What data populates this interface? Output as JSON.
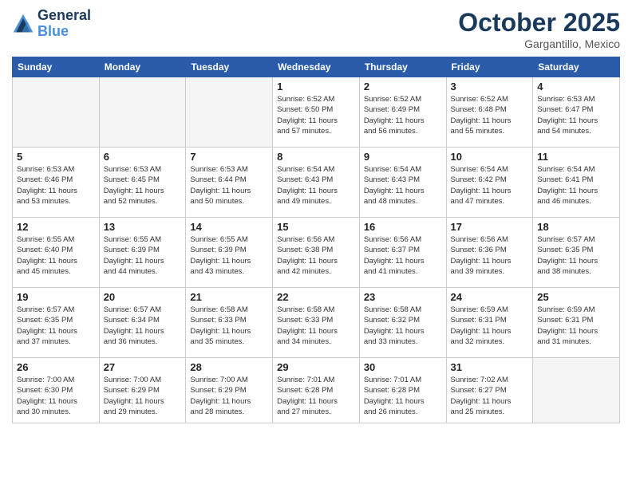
{
  "header": {
    "logo_line1": "General",
    "logo_line2": "Blue",
    "month": "October 2025",
    "location": "Gargantillo, Mexico"
  },
  "days_of_week": [
    "Sunday",
    "Monday",
    "Tuesday",
    "Wednesday",
    "Thursday",
    "Friday",
    "Saturday"
  ],
  "weeks": [
    [
      {
        "day": "",
        "info": ""
      },
      {
        "day": "",
        "info": ""
      },
      {
        "day": "",
        "info": ""
      },
      {
        "day": "1",
        "info": "Sunrise: 6:52 AM\nSunset: 6:50 PM\nDaylight: 11 hours\nand 57 minutes."
      },
      {
        "day": "2",
        "info": "Sunrise: 6:52 AM\nSunset: 6:49 PM\nDaylight: 11 hours\nand 56 minutes."
      },
      {
        "day": "3",
        "info": "Sunrise: 6:52 AM\nSunset: 6:48 PM\nDaylight: 11 hours\nand 55 minutes."
      },
      {
        "day": "4",
        "info": "Sunrise: 6:53 AM\nSunset: 6:47 PM\nDaylight: 11 hours\nand 54 minutes."
      }
    ],
    [
      {
        "day": "5",
        "info": "Sunrise: 6:53 AM\nSunset: 6:46 PM\nDaylight: 11 hours\nand 53 minutes."
      },
      {
        "day": "6",
        "info": "Sunrise: 6:53 AM\nSunset: 6:45 PM\nDaylight: 11 hours\nand 52 minutes."
      },
      {
        "day": "7",
        "info": "Sunrise: 6:53 AM\nSunset: 6:44 PM\nDaylight: 11 hours\nand 50 minutes."
      },
      {
        "day": "8",
        "info": "Sunrise: 6:54 AM\nSunset: 6:43 PM\nDaylight: 11 hours\nand 49 minutes."
      },
      {
        "day": "9",
        "info": "Sunrise: 6:54 AM\nSunset: 6:43 PM\nDaylight: 11 hours\nand 48 minutes."
      },
      {
        "day": "10",
        "info": "Sunrise: 6:54 AM\nSunset: 6:42 PM\nDaylight: 11 hours\nand 47 minutes."
      },
      {
        "day": "11",
        "info": "Sunrise: 6:54 AM\nSunset: 6:41 PM\nDaylight: 11 hours\nand 46 minutes."
      }
    ],
    [
      {
        "day": "12",
        "info": "Sunrise: 6:55 AM\nSunset: 6:40 PM\nDaylight: 11 hours\nand 45 minutes."
      },
      {
        "day": "13",
        "info": "Sunrise: 6:55 AM\nSunset: 6:39 PM\nDaylight: 11 hours\nand 44 minutes."
      },
      {
        "day": "14",
        "info": "Sunrise: 6:55 AM\nSunset: 6:39 PM\nDaylight: 11 hours\nand 43 minutes."
      },
      {
        "day": "15",
        "info": "Sunrise: 6:56 AM\nSunset: 6:38 PM\nDaylight: 11 hours\nand 42 minutes."
      },
      {
        "day": "16",
        "info": "Sunrise: 6:56 AM\nSunset: 6:37 PM\nDaylight: 11 hours\nand 41 minutes."
      },
      {
        "day": "17",
        "info": "Sunrise: 6:56 AM\nSunset: 6:36 PM\nDaylight: 11 hours\nand 39 minutes."
      },
      {
        "day": "18",
        "info": "Sunrise: 6:57 AM\nSunset: 6:35 PM\nDaylight: 11 hours\nand 38 minutes."
      }
    ],
    [
      {
        "day": "19",
        "info": "Sunrise: 6:57 AM\nSunset: 6:35 PM\nDaylight: 11 hours\nand 37 minutes."
      },
      {
        "day": "20",
        "info": "Sunrise: 6:57 AM\nSunset: 6:34 PM\nDaylight: 11 hours\nand 36 minutes."
      },
      {
        "day": "21",
        "info": "Sunrise: 6:58 AM\nSunset: 6:33 PM\nDaylight: 11 hours\nand 35 minutes."
      },
      {
        "day": "22",
        "info": "Sunrise: 6:58 AM\nSunset: 6:33 PM\nDaylight: 11 hours\nand 34 minutes."
      },
      {
        "day": "23",
        "info": "Sunrise: 6:58 AM\nSunset: 6:32 PM\nDaylight: 11 hours\nand 33 minutes."
      },
      {
        "day": "24",
        "info": "Sunrise: 6:59 AM\nSunset: 6:31 PM\nDaylight: 11 hours\nand 32 minutes."
      },
      {
        "day": "25",
        "info": "Sunrise: 6:59 AM\nSunset: 6:31 PM\nDaylight: 11 hours\nand 31 minutes."
      }
    ],
    [
      {
        "day": "26",
        "info": "Sunrise: 7:00 AM\nSunset: 6:30 PM\nDaylight: 11 hours\nand 30 minutes."
      },
      {
        "day": "27",
        "info": "Sunrise: 7:00 AM\nSunset: 6:29 PM\nDaylight: 11 hours\nand 29 minutes."
      },
      {
        "day": "28",
        "info": "Sunrise: 7:00 AM\nSunset: 6:29 PM\nDaylight: 11 hours\nand 28 minutes."
      },
      {
        "day": "29",
        "info": "Sunrise: 7:01 AM\nSunset: 6:28 PM\nDaylight: 11 hours\nand 27 minutes."
      },
      {
        "day": "30",
        "info": "Sunrise: 7:01 AM\nSunset: 6:28 PM\nDaylight: 11 hours\nand 26 minutes."
      },
      {
        "day": "31",
        "info": "Sunrise: 7:02 AM\nSunset: 6:27 PM\nDaylight: 11 hours\nand 25 minutes."
      },
      {
        "day": "",
        "info": ""
      }
    ]
  ]
}
